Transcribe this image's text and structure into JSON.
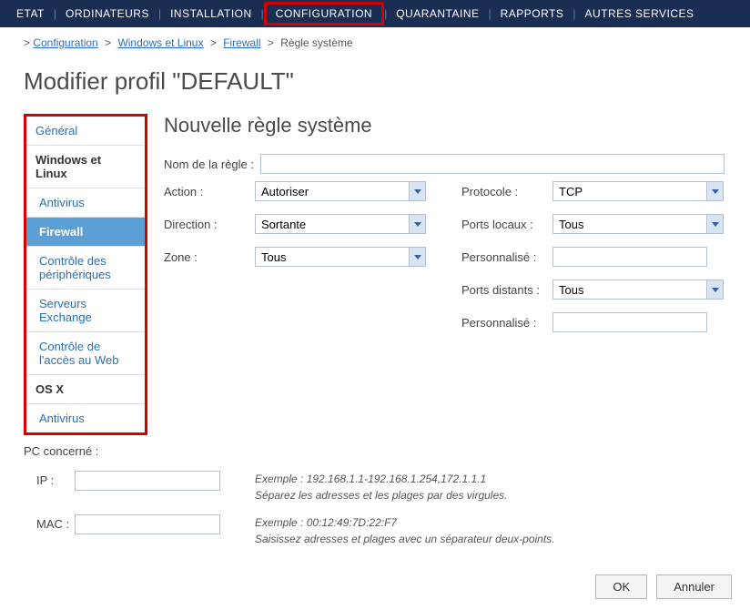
{
  "topnav": {
    "items": [
      "ETAT",
      "ORDINATEURS",
      "INSTALLATION",
      "CONFIGURATION",
      "QUARANTAINE",
      "RAPPORTS",
      "AUTRES SERVICES"
    ]
  },
  "breadcrumb": {
    "items": [
      "Configuration",
      "Windows et Linux",
      "Firewall"
    ],
    "current": "Règle système"
  },
  "page_title": "Modifier profil \"DEFAULT\"",
  "sidebar": {
    "items": [
      {
        "label": "Général"
      },
      {
        "label": "Windows et Linux"
      },
      {
        "label": "Antivirus"
      },
      {
        "label": "Firewall"
      },
      {
        "label": "Contrôle des périphériques"
      },
      {
        "label": "Serveurs Exchange"
      },
      {
        "label": "Contrôle de l'accès au Web"
      },
      {
        "label": "OS X"
      },
      {
        "label": "Antivirus"
      }
    ]
  },
  "section_title": "Nouvelle règle système",
  "form": {
    "rule_name_label": "Nom de la règle :",
    "rule_name_value": "",
    "action_label": "Action :",
    "action_value": "Autoriser",
    "direction_label": "Direction :",
    "direction_value": "Sortante",
    "zone_label": "Zone :",
    "zone_value": "Tous",
    "protocol_label": "Protocole :",
    "protocol_value": "TCP",
    "ports_local_label": "Ports locaux :",
    "ports_local_value": "Tous",
    "custom1_label": "Personnalisé :",
    "custom1_value": "",
    "ports_remote_label": "Ports distants :",
    "ports_remote_value": "Tous",
    "custom2_label": "Personnalisé :",
    "custom2_value": ""
  },
  "pc": {
    "title": "PC concerné :",
    "ip_label": "IP :",
    "ip_value": "",
    "ip_example_line1": "Exemple : 192.168.1.1-192.168.1.254,172.1.1.1",
    "ip_example_line2": "Séparez les adresses et les plages par des virgules.",
    "mac_label": "MAC :",
    "mac_value": "",
    "mac_example_line1": "Exemple : 00:12:49:7D:22:F7",
    "mac_example_line2": "Saisissez adresses et plages avec un séparateur deux-points."
  },
  "buttons": {
    "ok": "OK",
    "cancel": "Annuler"
  }
}
